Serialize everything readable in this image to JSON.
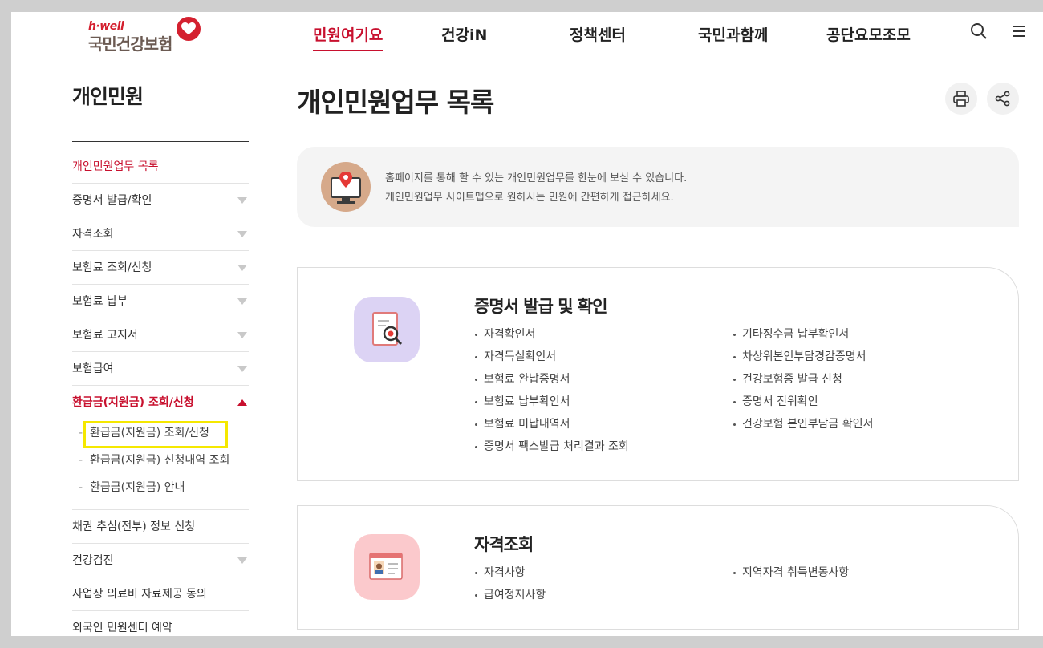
{
  "header": {
    "logo_sub": "h·well",
    "logo_name": "국민건강보험",
    "nav": [
      "민원여기요",
      "건강iN",
      "정책센터",
      "국민과함께",
      "공단요모조모"
    ]
  },
  "sidebar": {
    "title": "개인민원",
    "items": [
      {
        "label": "개인민원업무 목록"
      },
      {
        "label": "증명서 발급/확인"
      },
      {
        "label": "자격조회"
      },
      {
        "label": "보험료 조회/신청"
      },
      {
        "label": "보험료 납부"
      },
      {
        "label": "보험료 고지서"
      },
      {
        "label": "보험급여"
      },
      {
        "label": "환급금(지원금) 조회/신청"
      }
    ],
    "sub_items": [
      "환급금(지원금) 조회/신청",
      "환급금(지원금) 신청내역 조회",
      "환급금(지원금) 안내"
    ],
    "items_after": [
      "채권 추심(전부) 정보 신청",
      "건강검진",
      "사업장 의료비 자료제공 동의",
      "외국인 민원센터 예약"
    ]
  },
  "main": {
    "title": "개인민원업무 목록",
    "info_line1": "홈페이지를 통해 할 수 있는 개인민원업무를 한눈에 보실 수 있습니다.",
    "info_line2": "개인민원업무 사이트맵으로 원하시는 민원에 간편하게 접근하세요.",
    "cards": [
      {
        "title": "증명서 발급 및 확인",
        "left": [
          "자격확인서",
          "자격득실확인서",
          "보험료 완납증명서",
          "보험료 납부확인서",
          "보험료 미납내역서",
          "증명서 팩스발급 처리결과 조회"
        ],
        "right": [
          "기타징수금 납부확인서",
          "차상위본인부담경감증명서",
          "건강보험증 발급 신청",
          "증명서 진위확인",
          "건강보험 본인부담금 확인서"
        ]
      },
      {
        "title": "자격조회",
        "left": [
          "자격사항",
          "급여정지사항"
        ],
        "right": [
          "지역자격 취득변동사항"
        ]
      }
    ]
  },
  "colors": {
    "accent": "#c8102e",
    "highlight": "#f5e800"
  }
}
